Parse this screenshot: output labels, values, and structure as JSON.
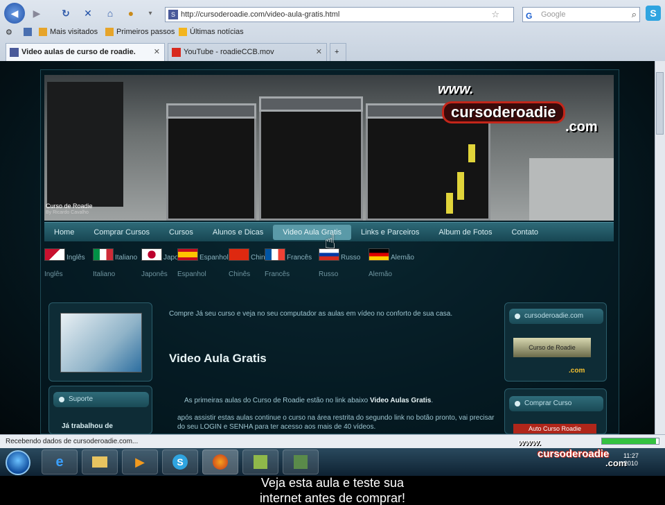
{
  "browser": {
    "address_url": "http://cursoderoadie.com/video-aula-gratis.html",
    "search_placeholder": "Google",
    "bookmarks": [
      "Mais visitados",
      "Primeiros passos",
      "Últimas notícias"
    ],
    "tabs": [
      {
        "label": "Video aulas de curso de roadie.",
        "active": true
      },
      {
        "label": "YouTube - roadieCCB.mov",
        "active": false
      }
    ],
    "status_text": "Recebendo dados de cursoderoadie.com...",
    "progress_fraction": 0.95
  },
  "site": {
    "banner": {
      "brand_line1": "www.",
      "brand_line2": "cursoderoadie",
      "brand_line3": ".com",
      "caption": "Curso de Roadie",
      "caption_sub": "By Ricardo Cavalho"
    },
    "menu": [
      "Home",
      "Comprar Cursos",
      "Cursos",
      "Alunos e Dicas",
      "Video Aula Gratis",
      "Links e Parceiros",
      "Album de Fotos",
      "Contato"
    ],
    "menu_active_index": 4,
    "languages": [
      {
        "name": "Inglês",
        "label": "Inglês"
      },
      {
        "name": "Italiano",
        "label": "Italiano"
      },
      {
        "name": "Japonês",
        "label": "Japonês"
      },
      {
        "name": "Espanhol",
        "label": "Espanhol"
      },
      {
        "name": "Chinês",
        "label": "Chinês"
      },
      {
        "name": "Francês",
        "label": "Francês"
      },
      {
        "name": "Russo",
        "label": "Russo"
      },
      {
        "name": "Alemão",
        "label": "Alemão"
      }
    ],
    "left_box_title": "Suporte",
    "left_box_text": "Já trabalhou de",
    "right_box1_title": "cursoderoadie.com",
    "right_box1_label": "Curso de Roadie",
    "right_box1_com": ".com",
    "right_box2_title": "Comprar Curso",
    "right_box2_label": "Auto Curso Roadie",
    "center": {
      "intro": "Compre Já seu curso e veja no seu computador as aulas em vídeo no conforto de sua casa.",
      "title": "Video Aula Gratis",
      "p1_pre": "As primeiras aulas do Curso de Roadie estão no link abaixo ",
      "p1_bold": "Video Aulas Gratis",
      "p2": "após assistir estas aulas continue o curso na área restrita do segundo link no botão pronto, vai precisar do seu LOGIN e SENHA para ter acesso aos mais de 40 vídeos."
    }
  },
  "taskbar": {
    "watermark1": "www.",
    "watermark2": "cursoderoadie",
    "watermark3": ".com",
    "clock_time": "11:27",
    "clock_date": "2010"
  },
  "subtitle": {
    "line1": "Veja esta aula e teste sua",
    "line2": "internet antes de comprar!"
  },
  "colors": {
    "menu_bg": "#174652",
    "page_bg": "#061a22",
    "accent_red": "#c4261a"
  }
}
